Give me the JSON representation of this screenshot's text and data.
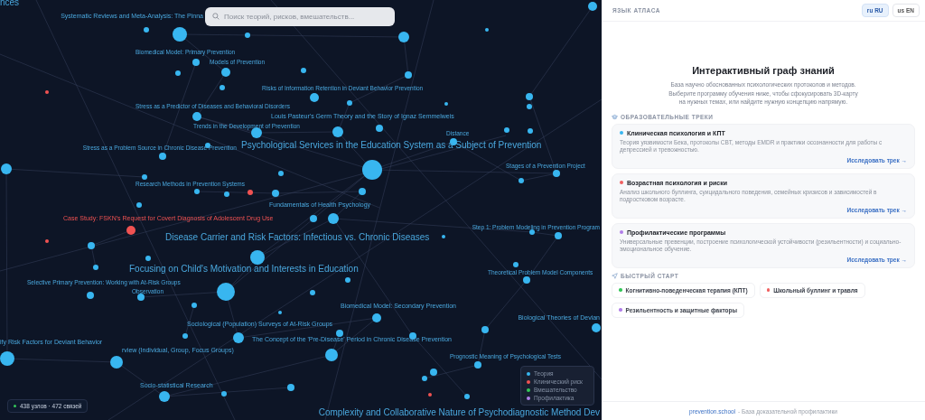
{
  "graph": {
    "search": {
      "placeholder": "Поиск теорий, рисков, вмешательств..."
    },
    "labels": [
      {
        "text": "nces",
        "kind": "large",
        "risk": false
      },
      {
        "text": "Systematic Reviews and Meta-Analysis: The Pinna",
        "kind": "medium",
        "risk": false
      },
      {
        "text": "Biomedical Model: Primary Prevention",
        "kind": "small",
        "risk": false
      },
      {
        "text": "Models of Prevention",
        "kind": "small",
        "risk": false
      },
      {
        "text": "Risks of Information Retention in Deviant Behavior Prevention",
        "kind": "small",
        "risk": false
      },
      {
        "text": "Stress as a Predictor of Diseases and Behavioral Disorders",
        "kind": "small",
        "risk": false
      },
      {
        "text": "Louis Pasteur's Germ Theory and the Story of Ignaz Semmelweis",
        "kind": "medium",
        "risk": false
      },
      {
        "text": "Trends in the Development of Prevention",
        "kind": "small",
        "risk": false
      },
      {
        "text": "Distance",
        "kind": "small",
        "risk": false
      },
      {
        "text": "Stress as a Problem Source in Chronic Disease Prevention",
        "kind": "small",
        "risk": false
      },
      {
        "text": "Psychological Services in the Education System as a Subject of Prevention",
        "kind": "large",
        "risk": false
      },
      {
        "text": "Stages of a Prevention Project",
        "kind": "small",
        "risk": false
      },
      {
        "text": "Research Methods in Prevention Systems",
        "kind": "small",
        "risk": false
      },
      {
        "text": "Fundamentals of Health Psychology",
        "kind": "medium",
        "risk": false
      },
      {
        "text": "Case Study: FSKN's Request for Covert Diagnosis of Adolescent Drug Use",
        "kind": "medium",
        "risk": true
      },
      {
        "text": "Step 1: Problem Modeling in Prevention Program",
        "kind": "small",
        "risk": false
      },
      {
        "text": "Disease Carrier and Risk Factors: Infectious vs. Chronic Diseases",
        "kind": "large",
        "risk": false
      },
      {
        "text": "Focusing on Child's Motivation and Interests in Education",
        "kind": "large",
        "risk": false
      },
      {
        "text": "Theoretical Problem Model Components",
        "kind": "small",
        "risk": false
      },
      {
        "text": "Selective Primary Prevention: Working with At-Risk Groups",
        "kind": "small",
        "risk": false
      },
      {
        "text": "Observation",
        "kind": "small",
        "risk": false
      },
      {
        "text": "Biomedical Model: Secondary Prevention",
        "kind": "medium",
        "risk": false
      },
      {
        "text": "Biological Theories of Devian",
        "kind": "medium",
        "risk": false
      },
      {
        "text": "Sociological (Population) Surveys of At-Risk Groups",
        "kind": "medium",
        "risk": false
      },
      {
        "text": "The Concept of the 'Pre-Disease' Period in Chronic Disease Prevention",
        "kind": "medium",
        "risk": false
      },
      {
        "text": "ify Risk Factors for Deviant Behavior",
        "kind": "medium",
        "risk": false
      },
      {
        "text": "rview (Individual, Group, Focus Groups)",
        "kind": "medium",
        "risk": false
      },
      {
        "text": "Prognostic Meaning of Psychological Tests",
        "kind": "small",
        "risk": false
      },
      {
        "text": "Socio-statistical Research",
        "kind": "medium",
        "risk": false
      },
      {
        "text": "Complexity and Collaborative Nature of Psychodiagnostic Method Dev",
        "kind": "large",
        "risk": false
      }
    ],
    "nodes": [
      {
        "color": "#38b6f0"
      },
      {
        "color": "#38b6f0"
      },
      {
        "color": "#38b6f0"
      },
      {
        "color": "#38b6f0"
      },
      {
        "color": "#38b6f0"
      },
      {
        "color": "#38b6f0"
      },
      {
        "color": "#38b6f0"
      },
      {
        "color": "#38b6f0"
      },
      {
        "color": "#38b6f0"
      },
      {
        "color": "#38b6f0"
      },
      {
        "color": "#38b6f0"
      },
      {
        "color": "#38b6f0"
      },
      {
        "color": "#38b6f0"
      },
      {
        "color": "#f05252"
      },
      {
        "color": "#38b6f0"
      },
      {
        "color": "#38b6f0"
      },
      {
        "color": "#38b6f0"
      },
      {
        "color": "#38b6f0"
      },
      {
        "color": "#f05252"
      },
      {
        "color": "#38b6f0"
      },
      {
        "color": "#38b6f0"
      },
      {
        "color": "#38b6f0"
      },
      {
        "color": "#38b6f0"
      },
      {
        "color": "#38b6f0"
      },
      {
        "color": "#38b6f0"
      },
      {
        "color": "#38b6f0"
      },
      {
        "color": "#38b6f0"
      },
      {
        "color": "#38b6f0"
      },
      {
        "color": "#38b6f0"
      },
      {
        "color": "#38b6f0"
      },
      {
        "color": "#38b6f0"
      },
      {
        "color": "#38b6f0"
      },
      {
        "color": "#38b6f0"
      },
      {
        "color": "#38b6f0"
      },
      {
        "color": "#38b6f0"
      },
      {
        "color": "#38b6f0"
      },
      {
        "color": "#38b6f0"
      },
      {
        "color": "#38b6f0"
      },
      {
        "color": "#38b6f0"
      },
      {
        "color": "#f05252"
      },
      {
        "color": "#38b6f0"
      },
      {
        "color": "#38b6f0"
      },
      {
        "color": "#38b6f0"
      },
      {
        "color": "#38b6f0"
      },
      {
        "color": "#38b6f0"
      },
      {
        "color": "#38b6f0"
      },
      {
        "color": "#38b6f0"
      },
      {
        "color": "#38b6f0"
      },
      {
        "color": "#38b6f0"
      },
      {
        "color": "#38b6f0"
      },
      {
        "color": "#38b6f0"
      },
      {
        "color": "#38b6f0"
      },
      {
        "color": "#38b6f0"
      },
      {
        "color": "#38b6f0"
      },
      {
        "color": "#38b6f0"
      },
      {
        "color": "#38b6f0"
      },
      {
        "color": "#f05252"
      },
      {
        "color": "#38b6f0"
      },
      {
        "color": "#38b6f0"
      },
      {
        "color": "#38b6f0"
      },
      {
        "color": "#38b6f0"
      },
      {
        "color": "#38b6f0"
      },
      {
        "color": "#38b6f0"
      },
      {
        "color": "#38b6f0"
      },
      {
        "color": "#38b6f0"
      },
      {
        "color": "#38b6f0"
      },
      {
        "color": "#38b6f0"
      },
      {
        "color": "#38b6f0"
      },
      {
        "color": "#38b6f0"
      },
      {
        "color": "#38b6f0"
      },
      {
        "color": "#38b6f0"
      },
      {
        "color": "#38b6f0"
      },
      {
        "color": "#38b6f0"
      },
      {
        "color": "#f05252"
      },
      {
        "color": "#38b6f0"
      },
      {
        "color": "#38b6f0"
      },
      {
        "color": "#38b6f0"
      }
    ],
    "stats": "438 узлов · 472 связей",
    "legend": [
      {
        "label": "Теория",
        "color": "#38b6f0"
      },
      {
        "label": "Клинический риск",
        "color": "#f05252"
      },
      {
        "label": "Вмешательство",
        "color": "#34c759"
      },
      {
        "label": "Профилактика",
        "color": "#b07ee8"
      }
    ]
  },
  "panel": {
    "language_label": "ЯЗЫК АТЛАСА",
    "languages": [
      {
        "flag": "ru",
        "code": "RU",
        "selected": true
      },
      {
        "flag": "us",
        "code": "EN",
        "selected": false
      }
    ],
    "title": "Интерактивный граф знаний",
    "description": "База научно обоснованных психологических протоколов и методов. Выберите программу обучения ниже, чтобы сфокусировать 3D-карту на нужных темах, или найдите нужную концепцию напрямую.",
    "tracks_heading": "ОБРАЗОВАТЕЛЬНЫЕ ТРЕКИ",
    "tracks": [
      {
        "title": "Клиническая психология и КПТ",
        "color": "#38b6f0",
        "description": "Теория уязвимости Бека, протоколы CBT, методы EMDR и практики осознанности для работы с депрессией и тревожностью.",
        "link": "Исследовать трек →"
      },
      {
        "title": "Возрастная психология и риски",
        "color": "#f06060",
        "description": "Анализ школьного буллинга, суицидального поведения, семейных кризисов и зависимостей в подростковом возрасте.",
        "link": "Исследовать трек →"
      },
      {
        "title": "Профилактические программы",
        "color": "#b07ee8",
        "description": "Универсальные превенции, построение психологической устойчивости (резильентности) и социально-эмоциональное обучение.",
        "link": "Исследовать трек →"
      }
    ],
    "quick_heading": "БЫСТРЫЙ СТАРТ",
    "quick_start": [
      {
        "label": "Когнитивно-поведенческая терапия (КПТ)",
        "color": "#34c759"
      },
      {
        "label": "Школьный буллинг и травля",
        "color": "#f06060"
      },
      {
        "label": "Резильентность и защитные факторы",
        "color": "#b07ee8"
      }
    ],
    "footer": {
      "link": "prevention.school",
      "text": "- База доказательной профилактики"
    }
  }
}
